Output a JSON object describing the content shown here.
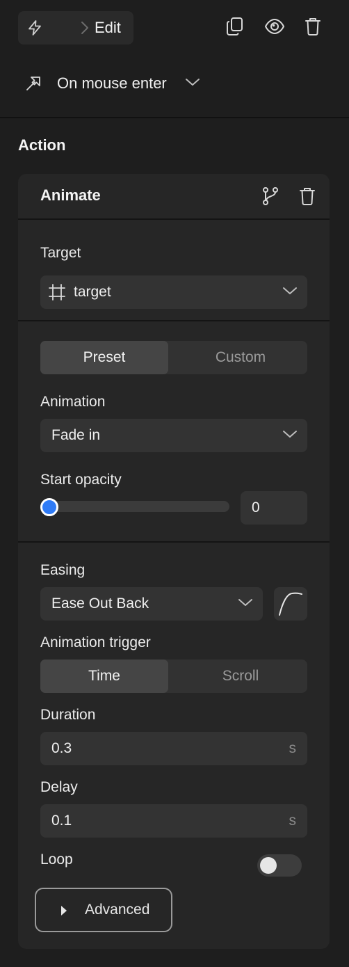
{
  "header": {
    "breadcrumb_label": "Edit",
    "icons": [
      "lightning-icon",
      "chevron-right-icon",
      "duplicate-icon",
      "preview-eye-icon",
      "trash-icon"
    ]
  },
  "trigger": {
    "label": "On mouse enter",
    "icon": "cursor-arrow-icon"
  },
  "section_title": "Action",
  "card": {
    "title": "Animate",
    "target": {
      "label": "Target",
      "value": "target",
      "icon": "frame-icon"
    },
    "mode_tabs": {
      "options": [
        "Preset",
        "Custom"
      ],
      "selected": "Preset"
    },
    "animation": {
      "label": "Animation",
      "value": "Fade in"
    },
    "start_opacity": {
      "label": "Start opacity",
      "value": "0",
      "slider_fraction": 0
    },
    "easing": {
      "label": "Easing",
      "value": "Ease Out Back"
    },
    "animation_trigger": {
      "label": "Animation trigger",
      "options": [
        "Time",
        "Scroll"
      ],
      "selected": "Time"
    },
    "duration": {
      "label": "Duration",
      "value": "0.3",
      "unit": "s"
    },
    "delay": {
      "label": "Delay",
      "value": "0.1",
      "unit": "s"
    },
    "loop": {
      "label": "Loop",
      "enabled": false
    },
    "advanced_label": "Advanced"
  },
  "colors": {
    "background": "#1e1e1e",
    "card": "#262626",
    "input": "#333333",
    "accent": "#2f7bf6"
  }
}
